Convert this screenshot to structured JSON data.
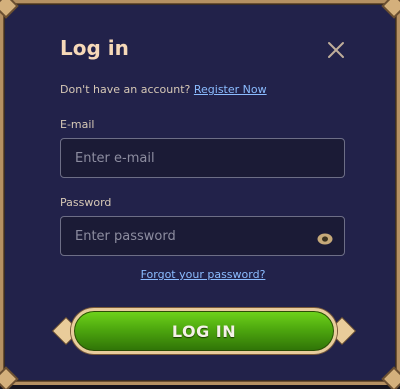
{
  "dialog": {
    "title": "Log in",
    "close_icon": "close-icon",
    "no_account_text": "Don't have an account?",
    "register_link": "Register Now"
  },
  "form": {
    "email_label": "E-mail",
    "email_placeholder": "Enter e-mail",
    "email_value": "",
    "password_label": "Password",
    "password_placeholder": "Enter password",
    "password_value": "",
    "eye_icon": "eye-icon",
    "forgot_link": "Forgot your password?",
    "submit_label": "LOG IN"
  },
  "colors": {
    "panel": "#22224a",
    "border_gold": "#b59062",
    "title": "#f6d9b8",
    "link": "#8bbcff",
    "button_green": "#4ea80f"
  }
}
